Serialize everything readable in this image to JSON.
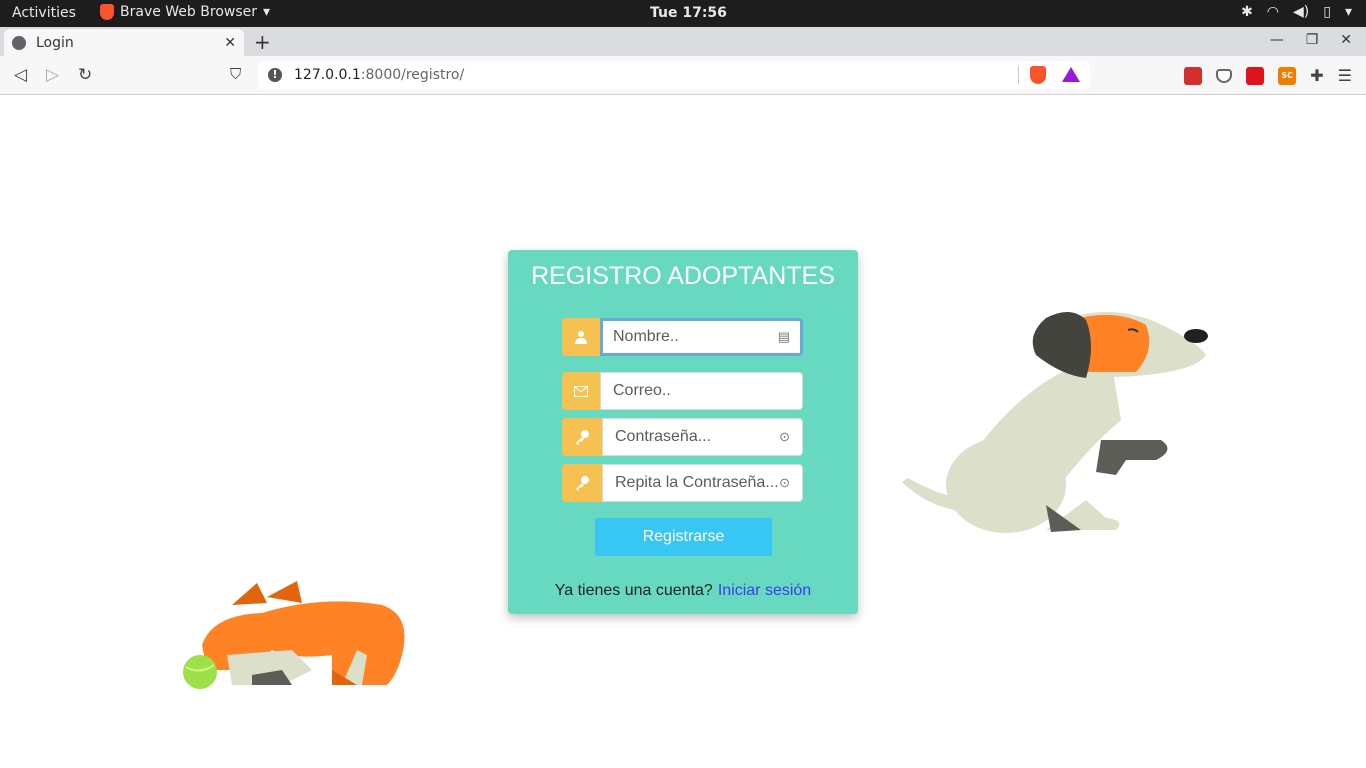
{
  "system": {
    "activities": "Activities",
    "app_name": "Brave Web Browser",
    "clock": "Tue 17:56"
  },
  "browser": {
    "tab_title": "Login",
    "url_host": "127.0.0.1",
    "url_path": ":8000/registro/"
  },
  "form": {
    "title": "REGISTRO ADOPTANTES",
    "name_placeholder": "Nombre..",
    "email_placeholder": "Correo..",
    "password_placeholder": "Contraseña...",
    "password2_placeholder": "Repita la Contraseña...",
    "submit_label": "Registrarse",
    "footer_text": "Ya tienes una cuenta?",
    "login_link": "Iniciar sesión"
  },
  "colors": {
    "card": "#67d9c1",
    "addon": "#f5c150",
    "button": "#38c6f4",
    "link": "#3b3bf0"
  }
}
